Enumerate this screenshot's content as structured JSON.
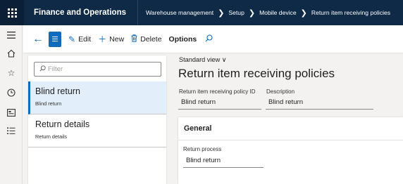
{
  "app": {
    "title": "Finance and Operations"
  },
  "breadcrumb": [
    "Warehouse management",
    "Setup",
    "Mobile device",
    "Return item receiving policies"
  ],
  "toolbar": {
    "edit_label": "Edit",
    "new_label": "New",
    "delete_label": "Delete",
    "options_label": "Options"
  },
  "filter": {
    "placeholder": "Filter"
  },
  "list": [
    {
      "title": "Blind return",
      "subtitle": "Blind return",
      "selected": true
    },
    {
      "title": "Return details",
      "subtitle": "Return details",
      "selected": false
    }
  ],
  "detail": {
    "view_label": "Standard view",
    "page_title": "Return item receiving policies",
    "id_label": "Return item receiving policy ID",
    "id_value": "Blind return",
    "description_label": "Description",
    "description_value": "Blind return",
    "general": {
      "header": "General",
      "return_process_label": "Return process",
      "return_process_value": "Blind return"
    }
  },
  "icons": [
    "waffle-icon",
    "back-arrow-icon",
    "list-view-icon",
    "edit-pencil-icon",
    "plus-icon",
    "delete-icon",
    "search-icon",
    "hamburger-icon",
    "home-icon",
    "star-icon",
    "clock-icon",
    "workspace-icon",
    "list-icon",
    "chevron-down-icon",
    "chevron-right-icon"
  ],
  "colors": {
    "nav": "#0f2a46",
    "accent": "#0f6cbd",
    "selected_row": "#e3eefb"
  }
}
